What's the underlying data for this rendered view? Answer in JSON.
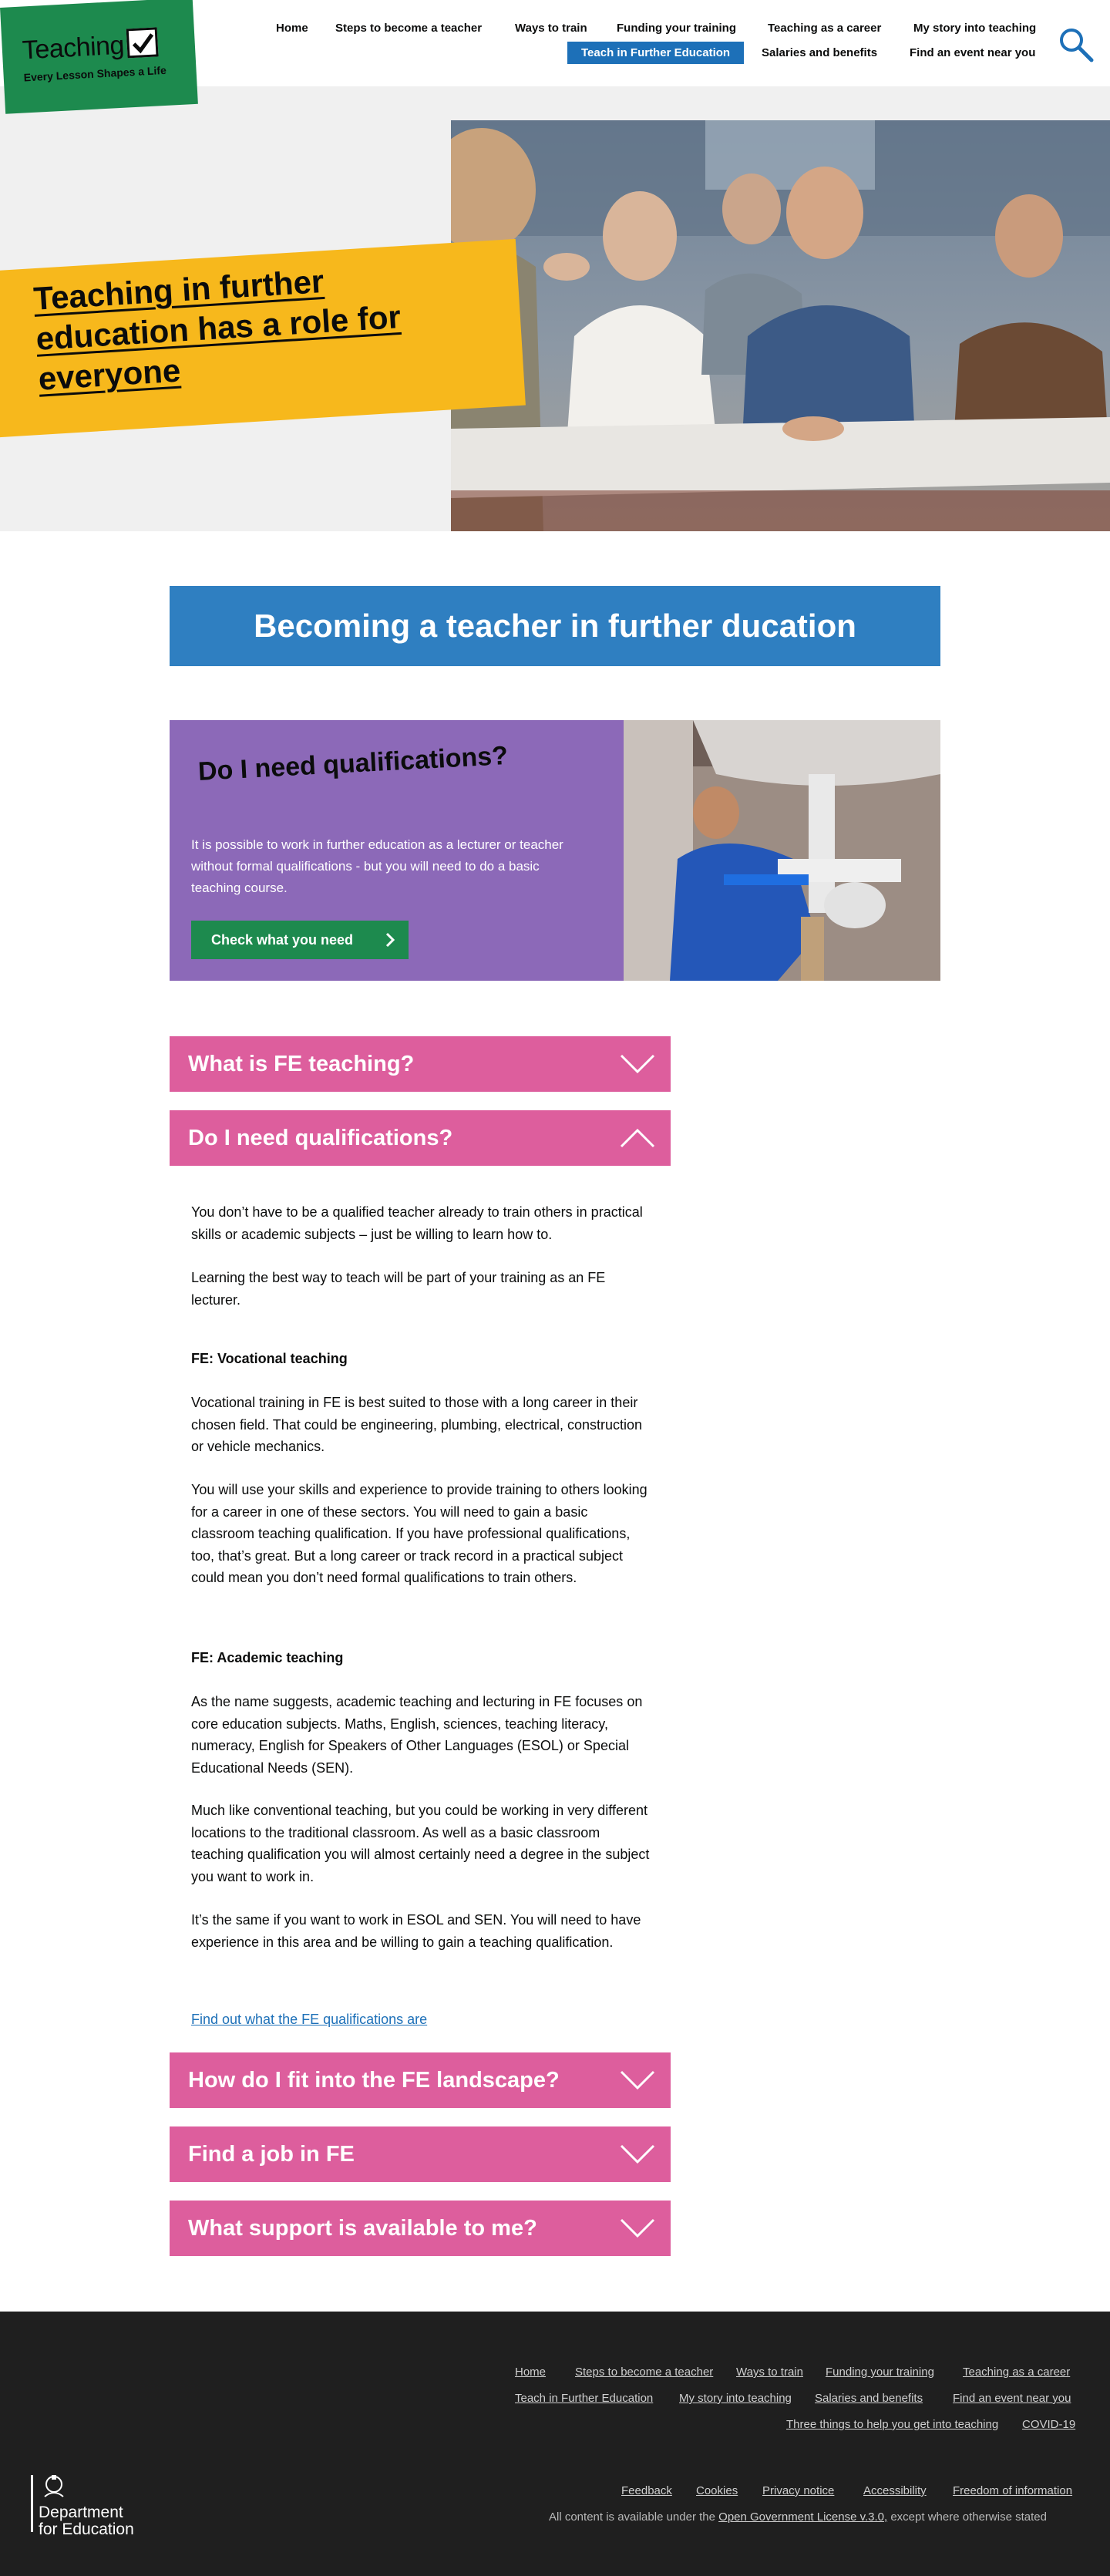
{
  "header": {
    "logo_word": "Teaching",
    "logo_tagline": "Every Lesson Shapes a Life",
    "nav_row1": [
      "Home",
      "Steps to become a teacher",
      "Ways to train",
      "Funding your training",
      "Teaching as a career",
      "My story into teaching"
    ],
    "nav_row2": [
      "Teach in Further Education",
      "Salaries and benefits",
      "Find an event near you"
    ],
    "active_item": "Teach in Further Education",
    "search_icon": "search-icon"
  },
  "hero": {
    "title": "Teaching in further education has a role for everyone"
  },
  "section_title": "Becoming a teacher in further ducation",
  "card": {
    "tag": "Do I need qualifications?",
    "text": "It is possible to work in further education as a lecturer or teacher without formal qualifications - but you will need to do a basic teaching course.",
    "button": "Check what you need"
  },
  "accordion": {
    "items": [
      {
        "label": "What is FE teaching?",
        "expanded": false
      },
      {
        "label": "Do I need qualifications?",
        "expanded": true
      },
      {
        "label": "How do I fit into the FE landscape?",
        "expanded": false
      },
      {
        "label": "Find a job in FE",
        "expanded": false
      },
      {
        "label": "What support is available to me?",
        "expanded": false
      }
    ],
    "content": {
      "p1": "You don’t have to be a qualified teacher already to train others in practical skills or academic subjects – just be willing to learn how to.",
      "p2": "Learning the best way to teach will be part of your training as an FE lecturer.",
      "h1": "FE: Vocational teaching",
      "p3": "Vocational training  in FE is best suited to those with a long career in their chosen field. That could be engineering, plumbing, electrical, construction or vehicle mechanics.",
      "p4": "You will use your skills and experience to provide training to others looking for a  career in one of these sectors. You will need to gain a basic classroom teaching qualification. If you have professional qualifications, too, that’s great. But a long career or track record in a practical subject could mean you don’t need formal qualifications to train others.",
      "h2": "FE: Academic teaching",
      "p5": "As the name suggests, academic teaching and lecturing in FE focuses on core education subjects. Maths, English, sciences, teaching literacy, numeracy, English for Speakers of Other Languages (ESOL) or Special Educational Needs (SEN).",
      "p6": "Much like conventional teaching, but you could be working in very different locations to the traditional classroom. As well as a basic classroom teaching qualification you will almost certainly need a degree in the subject you want to work in.",
      "p7": "It’s the same if you want to work in ESOL and SEN. You will need to have experience in this area and be willing to gain a teaching qualification.",
      "link": "Find out what the FE qualifications are"
    }
  },
  "footer": {
    "row1": [
      "Home",
      "Steps to become a teacher",
      "Ways to train",
      "Funding your training",
      "Teaching as a career"
    ],
    "row2": [
      "Teach in Further Education",
      "My story into teaching",
      "Salaries and benefits",
      "Find an event near you"
    ],
    "row3": [
      "Three things to help you get into teaching",
      "COVID-19"
    ],
    "legal": [
      "Feedback",
      "Cookies",
      "Privacy notice",
      "Accessibility",
      "Freedom of information"
    ],
    "licence_prefix": "All content is available under the",
    "licence_link": "Open Government License v.3.0,",
    "licence_suffix": "except where otherwise stated",
    "dfe_line1": "Department",
    "dfe_line2": "for Education"
  },
  "colors": {
    "brand_green": "#1d8a4e",
    "hero_yellow": "#f7b81c",
    "title_blue": "#2f7fc1",
    "card_purple": "#8c69b8",
    "accordion_pink": "#dd5e9d",
    "nav_active_blue": "#1d70b8",
    "footer_bg": "#1f1f1f"
  }
}
